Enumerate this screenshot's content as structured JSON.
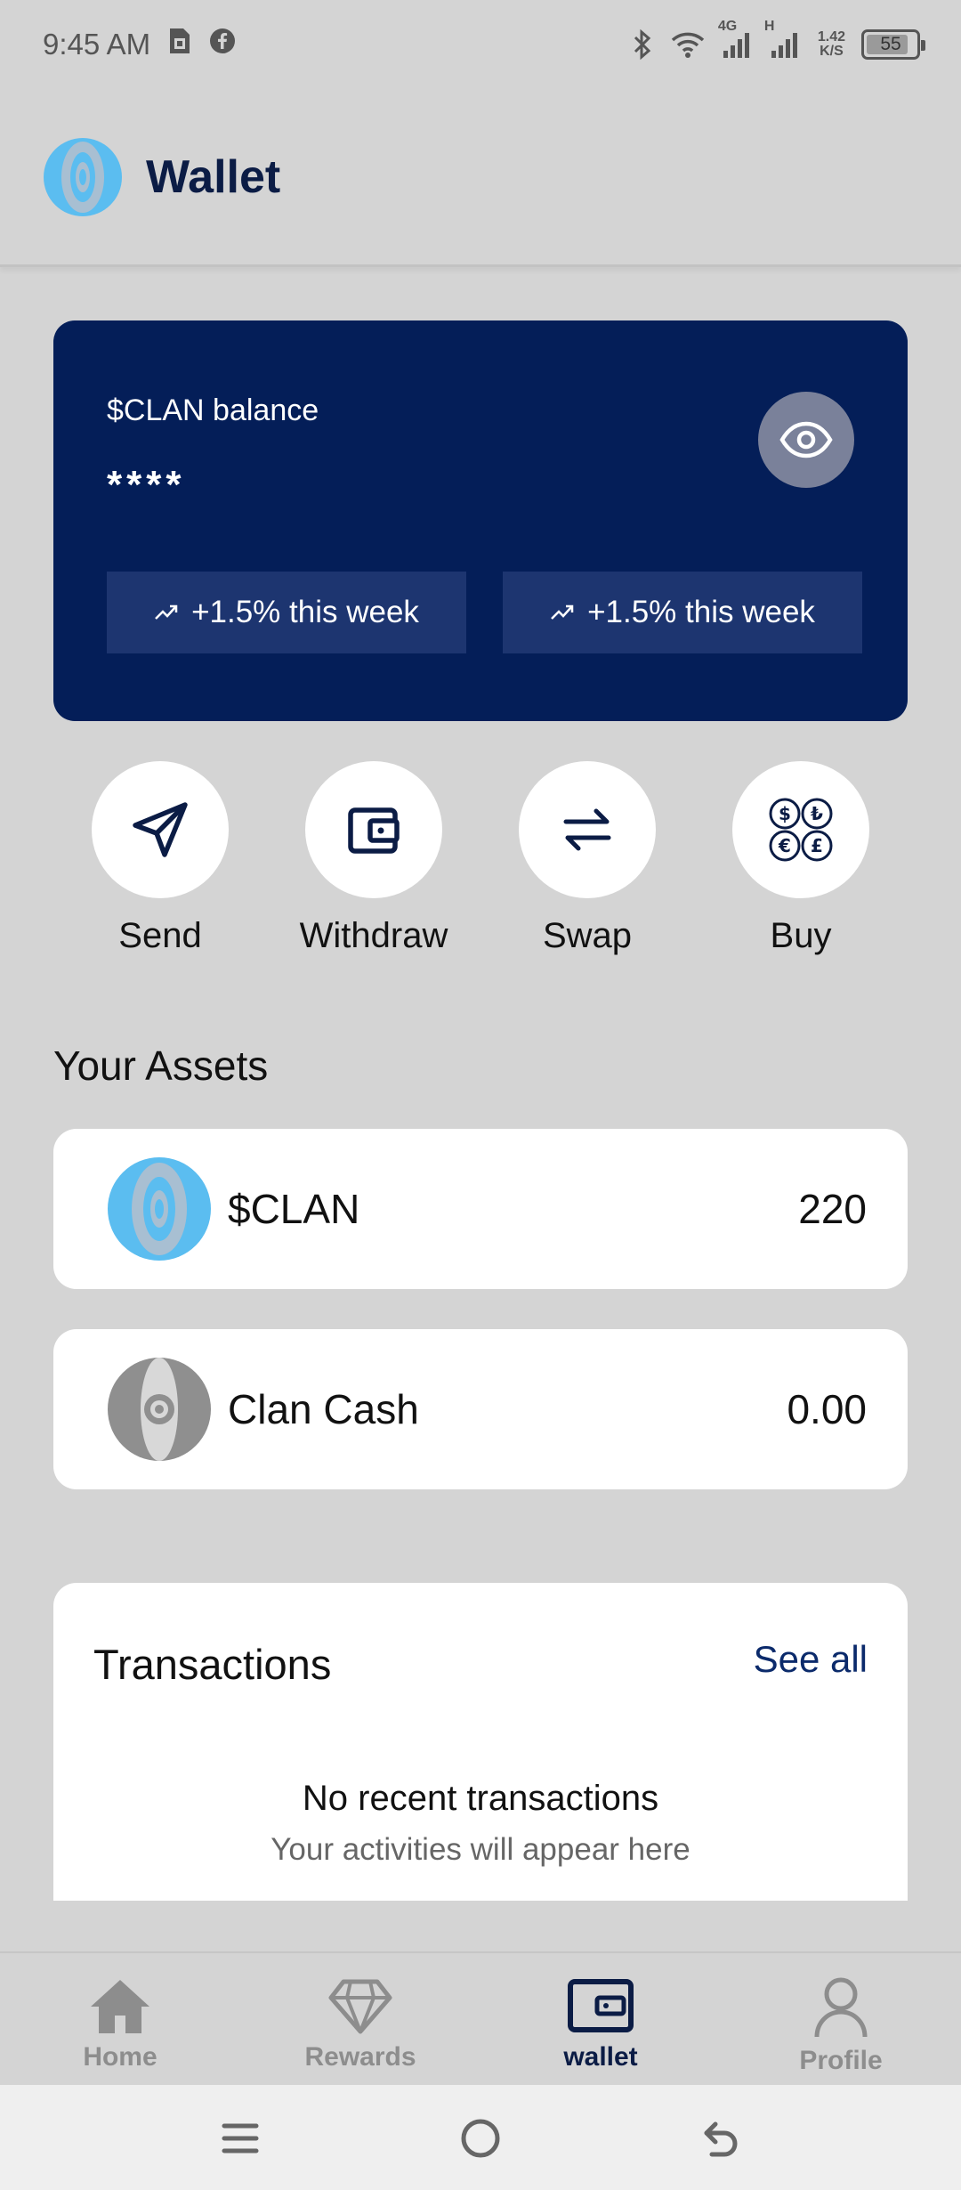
{
  "status_bar": {
    "time": "9:45 AM",
    "network_speed_value": "1.42",
    "network_speed_unit": "K/S",
    "network_4g": "4G",
    "network_h": "H",
    "battery": "55",
    "icons": [
      "sim-icon",
      "facebook-icon",
      "bluetooth-icon",
      "wifi-icon",
      "signal-icon"
    ]
  },
  "header": {
    "title": "Wallet",
    "logo": "clan-logo"
  },
  "balance_card": {
    "label": "$CLAN balance",
    "masked_value": "****",
    "trend_left": "+1.5% this week",
    "trend_right": "+1.5% this week",
    "eye_icon": "eye-icon",
    "background": "#041e58"
  },
  "actions": [
    {
      "label": "Send",
      "icon": "send-icon"
    },
    {
      "label": "Withdraw",
      "icon": "wallet-icon"
    },
    {
      "label": "Swap",
      "icon": "swap-icon"
    },
    {
      "label": "Buy",
      "icon": "currency-icon"
    }
  ],
  "assets": {
    "title": "Your Assets",
    "items": [
      {
        "name": "$CLAN",
        "amount": "220"
      },
      {
        "name": "Clan Cash",
        "amount": "0.00"
      }
    ]
  },
  "transactions": {
    "title": "Transactions",
    "see_all": "See all",
    "empty_title": "No recent transactions",
    "empty_subtitle": "Your activities will appear here"
  },
  "bottom_nav": {
    "items": [
      {
        "label": "Home",
        "icon": "home-icon"
      },
      {
        "label": "Rewards",
        "icon": "diamond-icon"
      },
      {
        "label": "wallet",
        "icon": "wallet-icon"
      },
      {
        "label": "Profile",
        "icon": "profile-icon"
      }
    ],
    "active": "wallet",
    "active_color": "#0b1c45"
  }
}
